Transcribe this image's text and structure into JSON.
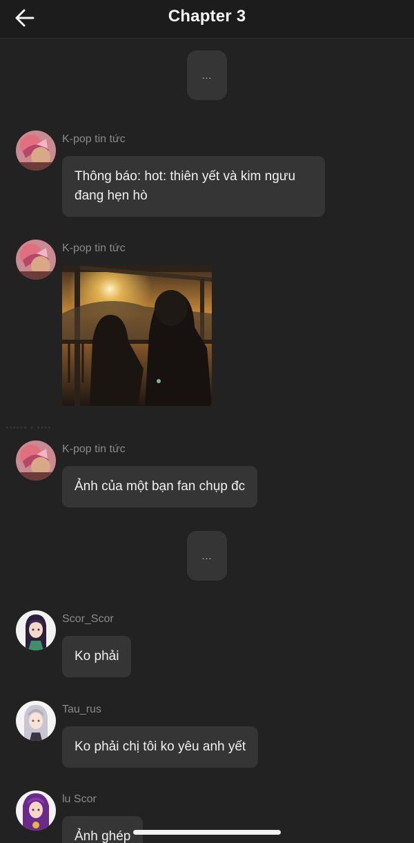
{
  "header": {
    "title": "Chapter 3",
    "back_icon": "arrow-left-icon"
  },
  "typing_indicators": [
    "...",
    "..."
  ],
  "messages": [
    {
      "sender": "K-pop tin tức",
      "type": "text",
      "text": "Thông báo: hot: thiên yết và kim ngưu đang hẹn hò"
    },
    {
      "sender": "K-pop tin tức",
      "type": "image",
      "image": "couple-sunset-photo"
    },
    {
      "sender": "K-pop tin tức",
      "type": "text",
      "text": "Ảnh của một bạn fan chụp đc"
    },
    {
      "sender": "Scor_Scor",
      "type": "text",
      "text": "Ko phải"
    },
    {
      "sender": "Tau_rus",
      "type": "text",
      "text": "Ko phải chị tôi ko yêu anh yết"
    },
    {
      "sender": "lu Scor",
      "type": "text",
      "text": "Ảnh ghép"
    }
  ],
  "colors": {
    "background": "#222222",
    "bubble": "#353535",
    "header": "#1c1c1c",
    "sender_text": "#8a8a8a"
  }
}
